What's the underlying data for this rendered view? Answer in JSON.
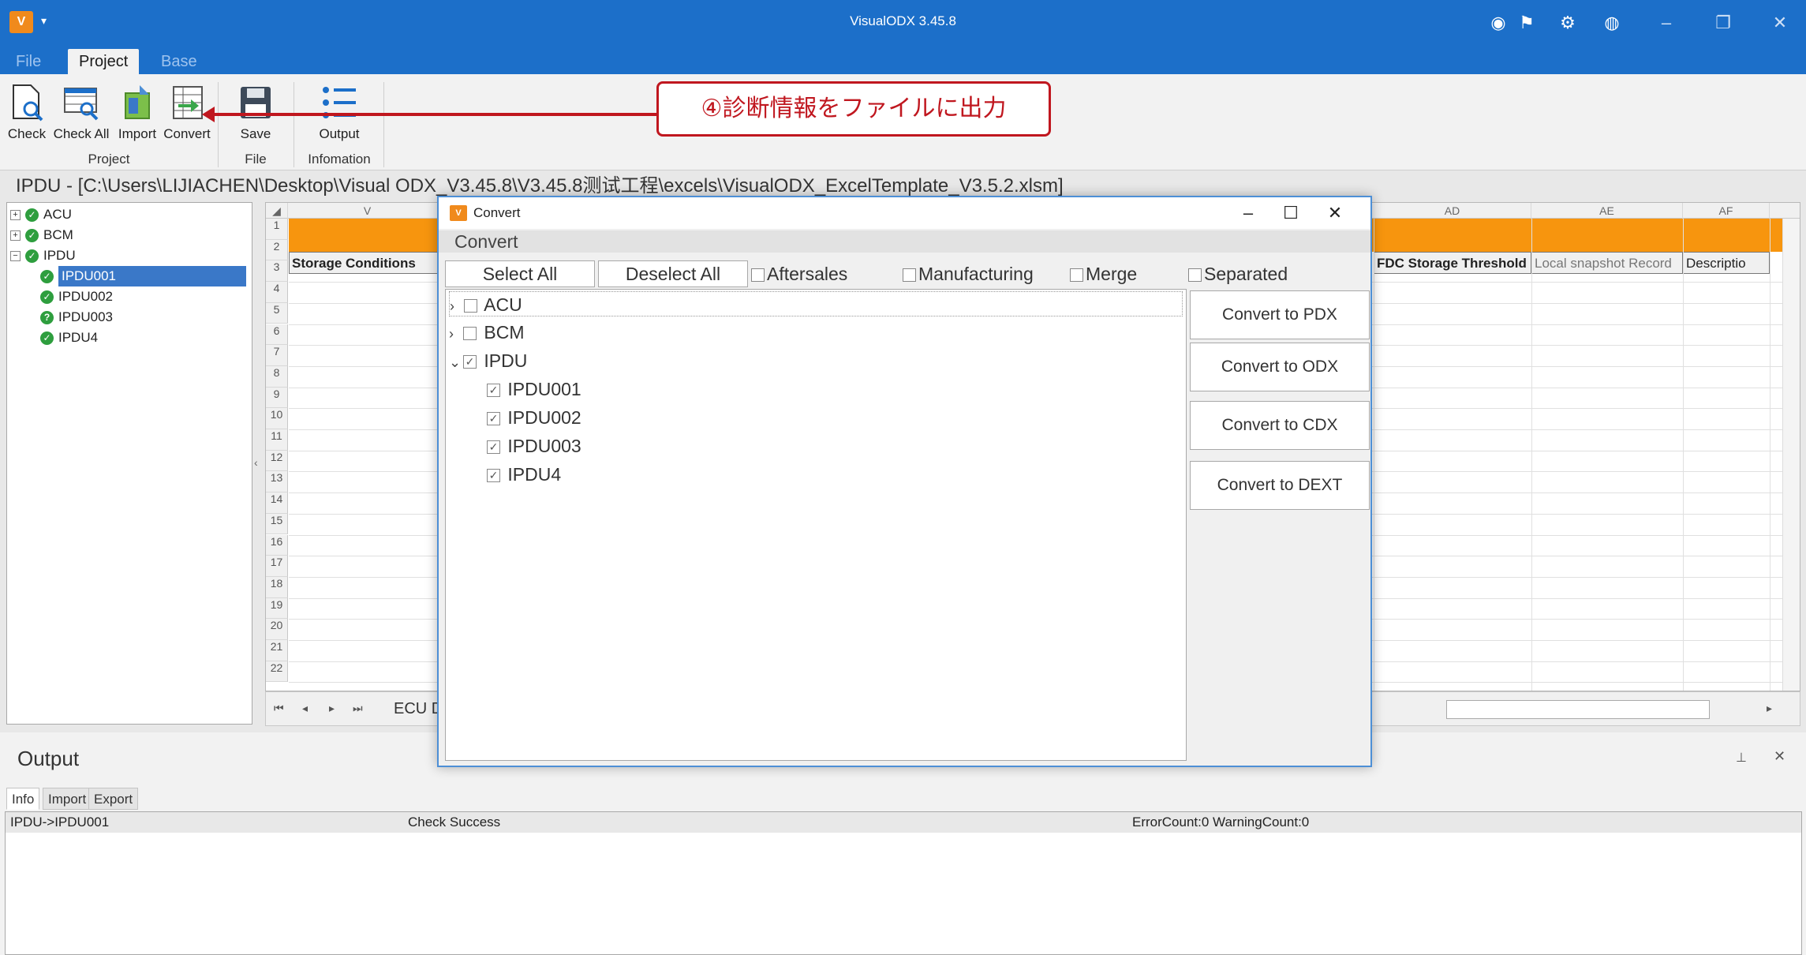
{
  "app": {
    "title": "VisualODX 3.45.8",
    "logo_text": "V"
  },
  "menu": {
    "items": [
      "File",
      "Project",
      "Base"
    ],
    "active": "Project"
  },
  "ribbon": {
    "buttons": [
      "Check",
      "Check All",
      "Import",
      "Convert",
      "Save",
      "Output"
    ],
    "groups": [
      "Project",
      "File",
      "Infomation"
    ]
  },
  "callout": {
    "text": "④診断情報をファイルに出力"
  },
  "path_bar": {
    "text": "IPDU - [C:\\Users\\LIJIACHEN\\Desktop\\Visual ODX_V3.45.8\\V3.45.8测试工程\\excels\\VisualODX_ExcelTemplate_V3.5.2.xlsm]"
  },
  "project_tree": {
    "nodes": [
      "ACU",
      "BCM",
      "IPDU"
    ],
    "children": [
      "IPDU001",
      "IPDU002",
      "IPDU003",
      "IPDU4"
    ],
    "selected": "IPDU001"
  },
  "grid": {
    "columns": [
      "V",
      "AD",
      "AE",
      "AF"
    ],
    "rows": [
      "1",
      "2",
      "3",
      "4",
      "5",
      "6",
      "7",
      "8",
      "9",
      "10",
      "11",
      "12",
      "13",
      "14",
      "15",
      "16",
      "17",
      "18",
      "19",
      "20",
      "21",
      "22"
    ],
    "header_cells": [
      "Storage Conditions",
      "FDC Storage Threshold",
      "Local snapshot Record",
      "Descriptio"
    ],
    "sheet_name": "ECU D"
  },
  "output": {
    "title": "Output",
    "tabs": [
      "Info",
      "Import",
      "Export"
    ],
    "row": {
      "source": "IPDU->IPDU001",
      "message": "Check Success",
      "counts": "ErrorCount:0 WarningCount:0"
    }
  },
  "dialog": {
    "title": "Convert",
    "heading": "Convert",
    "select_all": "Select All",
    "deselect_all": "Deselect All",
    "options": [
      "Aftersales",
      "Manufacturing",
      "Merge",
      "Separated"
    ],
    "tree": {
      "nodes": [
        {
          "label": "ACU",
          "checked": false,
          "expanded": false
        },
        {
          "label": "BCM",
          "checked": false,
          "expanded": false
        },
        {
          "label": "IPDU",
          "checked": true,
          "expanded": true
        }
      ],
      "children": [
        "IPDU001",
        "IPDU002",
        "IPDU003",
        "IPDU4"
      ]
    },
    "buttons": [
      "Convert to PDX",
      "Convert to ODX",
      "Convert to CDX",
      "Convert to DEXT"
    ]
  },
  "colors": {
    "title_blue": "#1c6fc9",
    "orange": "#f7950e",
    "accent_red": "#c0171f",
    "status_green": "#2e9e3e",
    "selection_blue": "#3a78c8"
  }
}
